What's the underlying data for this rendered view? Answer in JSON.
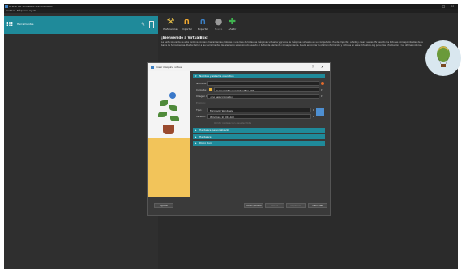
{
  "window": {
    "title": "Oracle VM VirtualBox Administrador",
    "controls": [
      "—",
      "□",
      "✕"
    ]
  },
  "menu": [
    "Archivo",
    "Máquina",
    "Ayuda"
  ],
  "sidebar": {
    "tools_label": "Herramientas"
  },
  "toolbar": {
    "items": [
      {
        "label": "Preferencias",
        "icon": "wrench-icon",
        "color": "#e8c04a"
      },
      {
        "label": "Importar",
        "icon": "import-icon",
        "color": "#f0a830"
      },
      {
        "label": "Exportar",
        "icon": "export-icon",
        "color": "#3b7fc4"
      },
      {
        "label": "Nueva",
        "icon": "new-icon",
        "color": "#9a9a9a"
      },
      {
        "label": "Añadir",
        "icon": "add-icon",
        "color": "#3fb34f"
      }
    ]
  },
  "welcome": {
    "title": "¡Bienvenido a VirtualBox!",
    "text": "La parte izquierda de esta ventana contiene herramientas globales y una lista de todas las máquinas virtuales y grupos de máquinas virtuales en su computador. Puede importar, añadir y crear nuevas MV usando los botones correspondientes de la barra de herramientas. Puede llamar a las herramientas del elemento seleccionado usando el botón de elemento correspondiente. Puede encontrar la última información y noticias en www.virtualbox.org para más información y las últimas noticias."
  },
  "dialog": {
    "title": "Crear máquina virtual",
    "help": "?",
    "close": "✕",
    "sections": [
      {
        "label": "Nombre y sistema operativo",
        "expanded": true
      },
      {
        "label": "Hardware personalizado",
        "expanded": false
      },
      {
        "label": "Hardware",
        "expanded": false
      },
      {
        "label": "Disco duro",
        "expanded": false
      }
    ],
    "fields": {
      "name_label": "Nombre:",
      "name_value": "",
      "folder_label": "Carpeta:",
      "folder_value": "C:\\Users\\Equipo\\VirtualBox VMs",
      "iso_label": "Imagen ISO:",
      "iso_value": "<no seleccionado>",
      "edition_label": "Edición:",
      "type_label": "Tipo:",
      "type_value": "Microsoft Windows",
      "version_label": "Versión:",
      "version_value": "Windows 10 (64-bit)",
      "unattended_note": "Omitir instalación desatendida"
    },
    "buttons": {
      "help": "Ayuda",
      "expert": "Modo guiado",
      "back": "Atrás",
      "next": "Siguiente",
      "finish": "Terminar",
      "cancel": "Cancelar"
    }
  }
}
